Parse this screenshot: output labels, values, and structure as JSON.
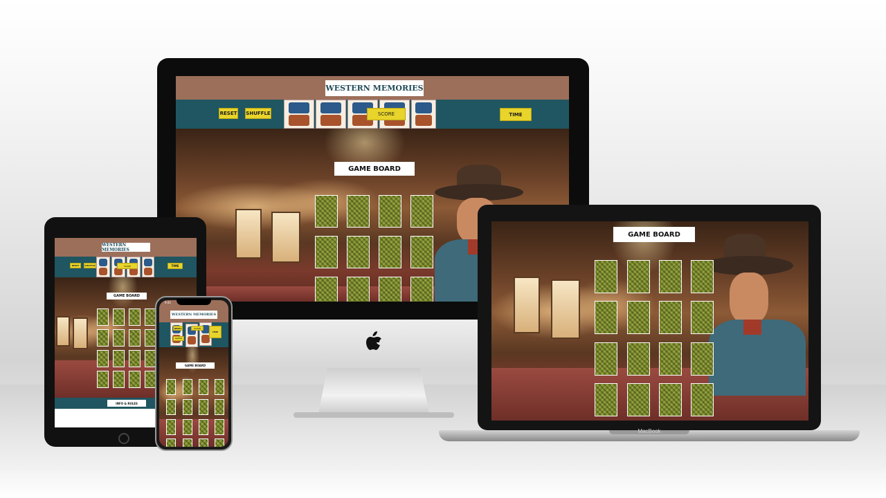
{
  "app": {
    "title": "WESTERN MEMORIES",
    "buttons": {
      "reset": "RESET",
      "shuffle": "SHUFFLE",
      "score": "SCORE",
      "time": "TIME"
    },
    "board_label": "GAME BOARD",
    "info_rules": "INFO & RULES"
  },
  "devices": {
    "laptop_brand": "MacBook",
    "phone_status_time": "9:41"
  },
  "colors": {
    "header_brown": "#9c6f5a",
    "header_teal": "#1f5661",
    "button_yellow": "#e8d42a",
    "card_back": "#7a8a2a"
  }
}
